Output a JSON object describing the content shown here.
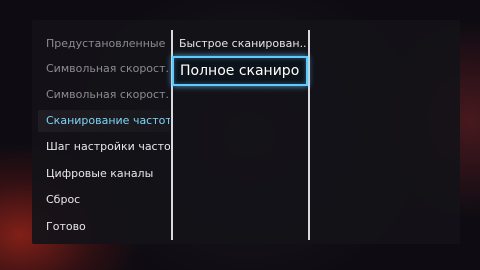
{
  "menu": {
    "items": [
      {
        "label": "Предустановленные ...",
        "state": "dim"
      },
      {
        "label": "Символьная скорост...",
        "state": "dim"
      },
      {
        "label": "Символьная скорост...",
        "state": "dim"
      },
      {
        "label": "Сканирование частот...",
        "state": "selected"
      },
      {
        "label": "Шаг настройки часто...",
        "state": "normal"
      },
      {
        "label": "Цифровые каналы",
        "state": "normal"
      },
      {
        "label": "Сброс",
        "state": "normal"
      },
      {
        "label": "Готово",
        "state": "normal"
      }
    ]
  },
  "options": {
    "items": [
      {
        "label": "Быстрое сканирован..."
      },
      {
        "label": "Полное сканиро",
        "state": "focused"
      }
    ]
  },
  "colors": {
    "selected_text": "#7fd4f6",
    "focus_border": "#5fc9ff",
    "dim_text": "#8e8b92",
    "normal_text": "#e8e8ec"
  }
}
